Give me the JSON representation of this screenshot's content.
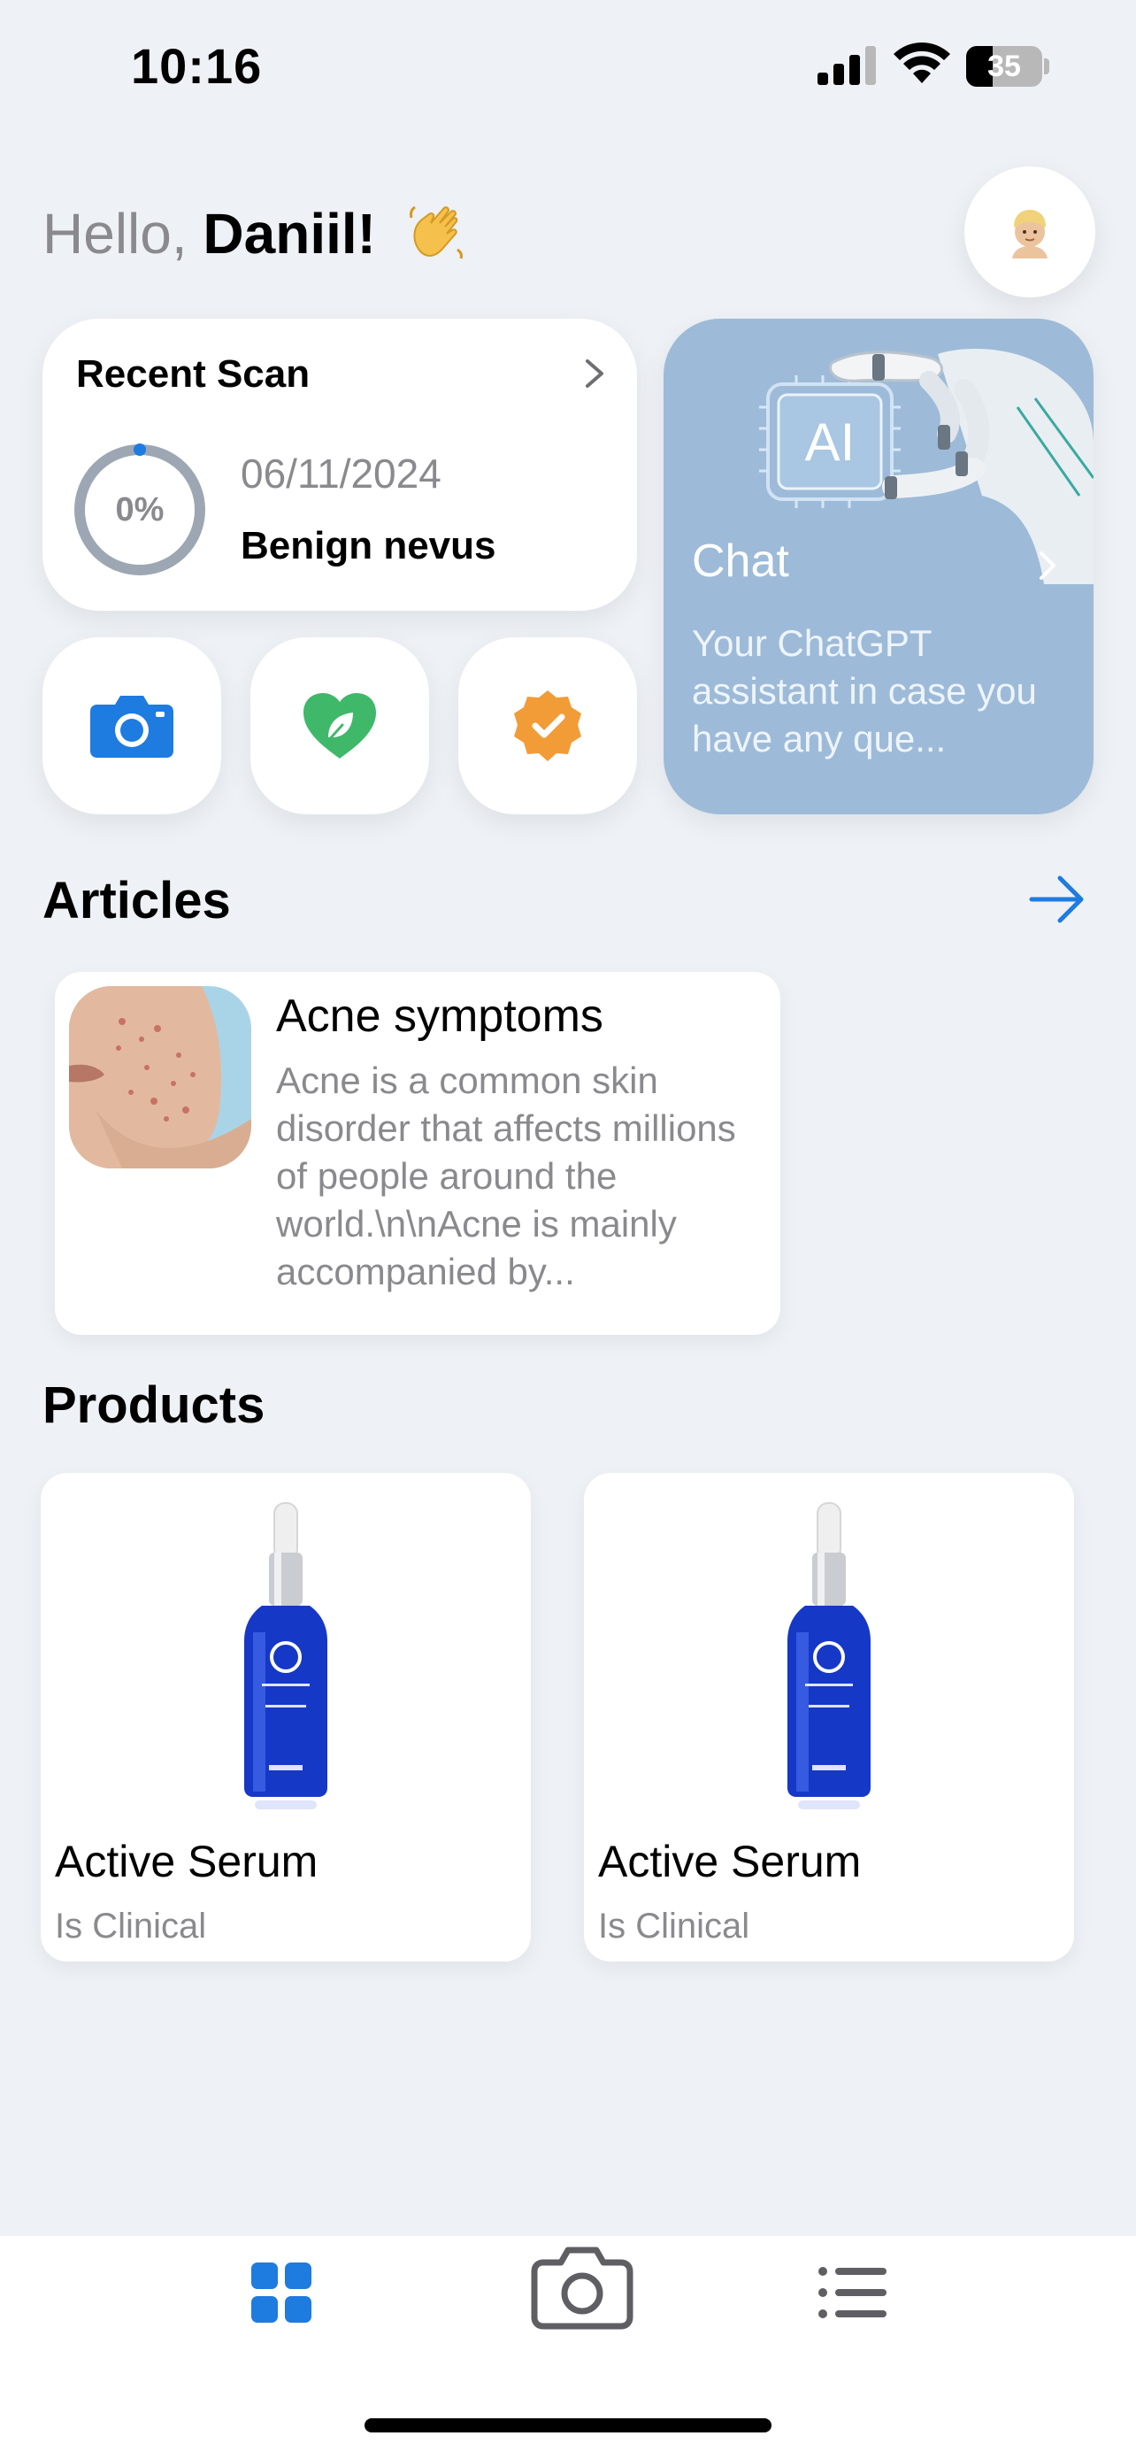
{
  "status_bar": {
    "time": "10:16",
    "battery_level": "35",
    "battery_percent": 0.35,
    "signal_icon": "cellular-signal-icon",
    "wifi_icon": "wifi-icon",
    "battery_icon": "battery-icon"
  },
  "greeting": {
    "hello": "Hello, ",
    "name": "Daniil!",
    "wave_icon": "waving-hand-icon"
  },
  "avatar": {
    "icon": "person-avatar-icon"
  },
  "recent_scan": {
    "title": "Recent Scan",
    "progress_label": "0%",
    "progress": 0.0,
    "date": "06/11/2024",
    "result": "Benign nevus",
    "chevron_icon": "chevron-right-icon"
  },
  "quick_actions": [
    {
      "icon": "camera-icon",
      "color": "#1E7BE0"
    },
    {
      "icon": "heart-leaf-icon",
      "color": "#3FB86A"
    },
    {
      "icon": "verified-badge-icon",
      "color": "#F29C38"
    }
  ],
  "chat": {
    "title": "Chat",
    "description": "Your ChatGPT assistant in case you have any que...",
    "badge": "AI",
    "background": "#9DBBD8",
    "chevron_icon": "chevron-right-icon"
  },
  "articles": {
    "title": "Articles",
    "arrow_icon": "arrow-right-icon",
    "items": [
      {
        "title": "Acne symptoms",
        "excerpt": "Acne is a common skin disorder that affects millions of people around the world.\\n\\nAcne is mainly accompanied by..."
      }
    ]
  },
  "products": {
    "title": "Products",
    "items": [
      {
        "name": "Active Serum",
        "brand": "Is Clinical"
      },
      {
        "name": "Active Serum",
        "brand": "Is Clinical"
      }
    ]
  },
  "tab_bar": {
    "accent": "#1E7BE0",
    "inactive": "#5F5F63",
    "tabs": [
      {
        "icon": "grid-icon",
        "active": true
      },
      {
        "icon": "camera-icon",
        "active": false
      },
      {
        "icon": "list-icon",
        "active": false
      }
    ]
  }
}
